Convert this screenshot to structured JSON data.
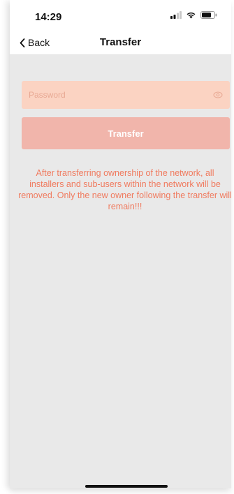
{
  "status_bar": {
    "time": "14:29",
    "icons": [
      "signal-icon",
      "wifi-icon",
      "battery-icon"
    ]
  },
  "nav": {
    "back_label": "Back",
    "title": "Transfer"
  },
  "form": {
    "password_placeholder": "Password",
    "password_value": "",
    "transfer_label": "Transfer"
  },
  "warning_text": "After transferring ownership of the network, all installers and sub-users within the network will be removed. Only the new owner following the transfer will remain!!!",
  "colors": {
    "field_bg": "#fbd3c2",
    "button_bg": "#f1b5ab",
    "warning_text": "#f07b5f",
    "page_bg": "#e9e9e9"
  }
}
